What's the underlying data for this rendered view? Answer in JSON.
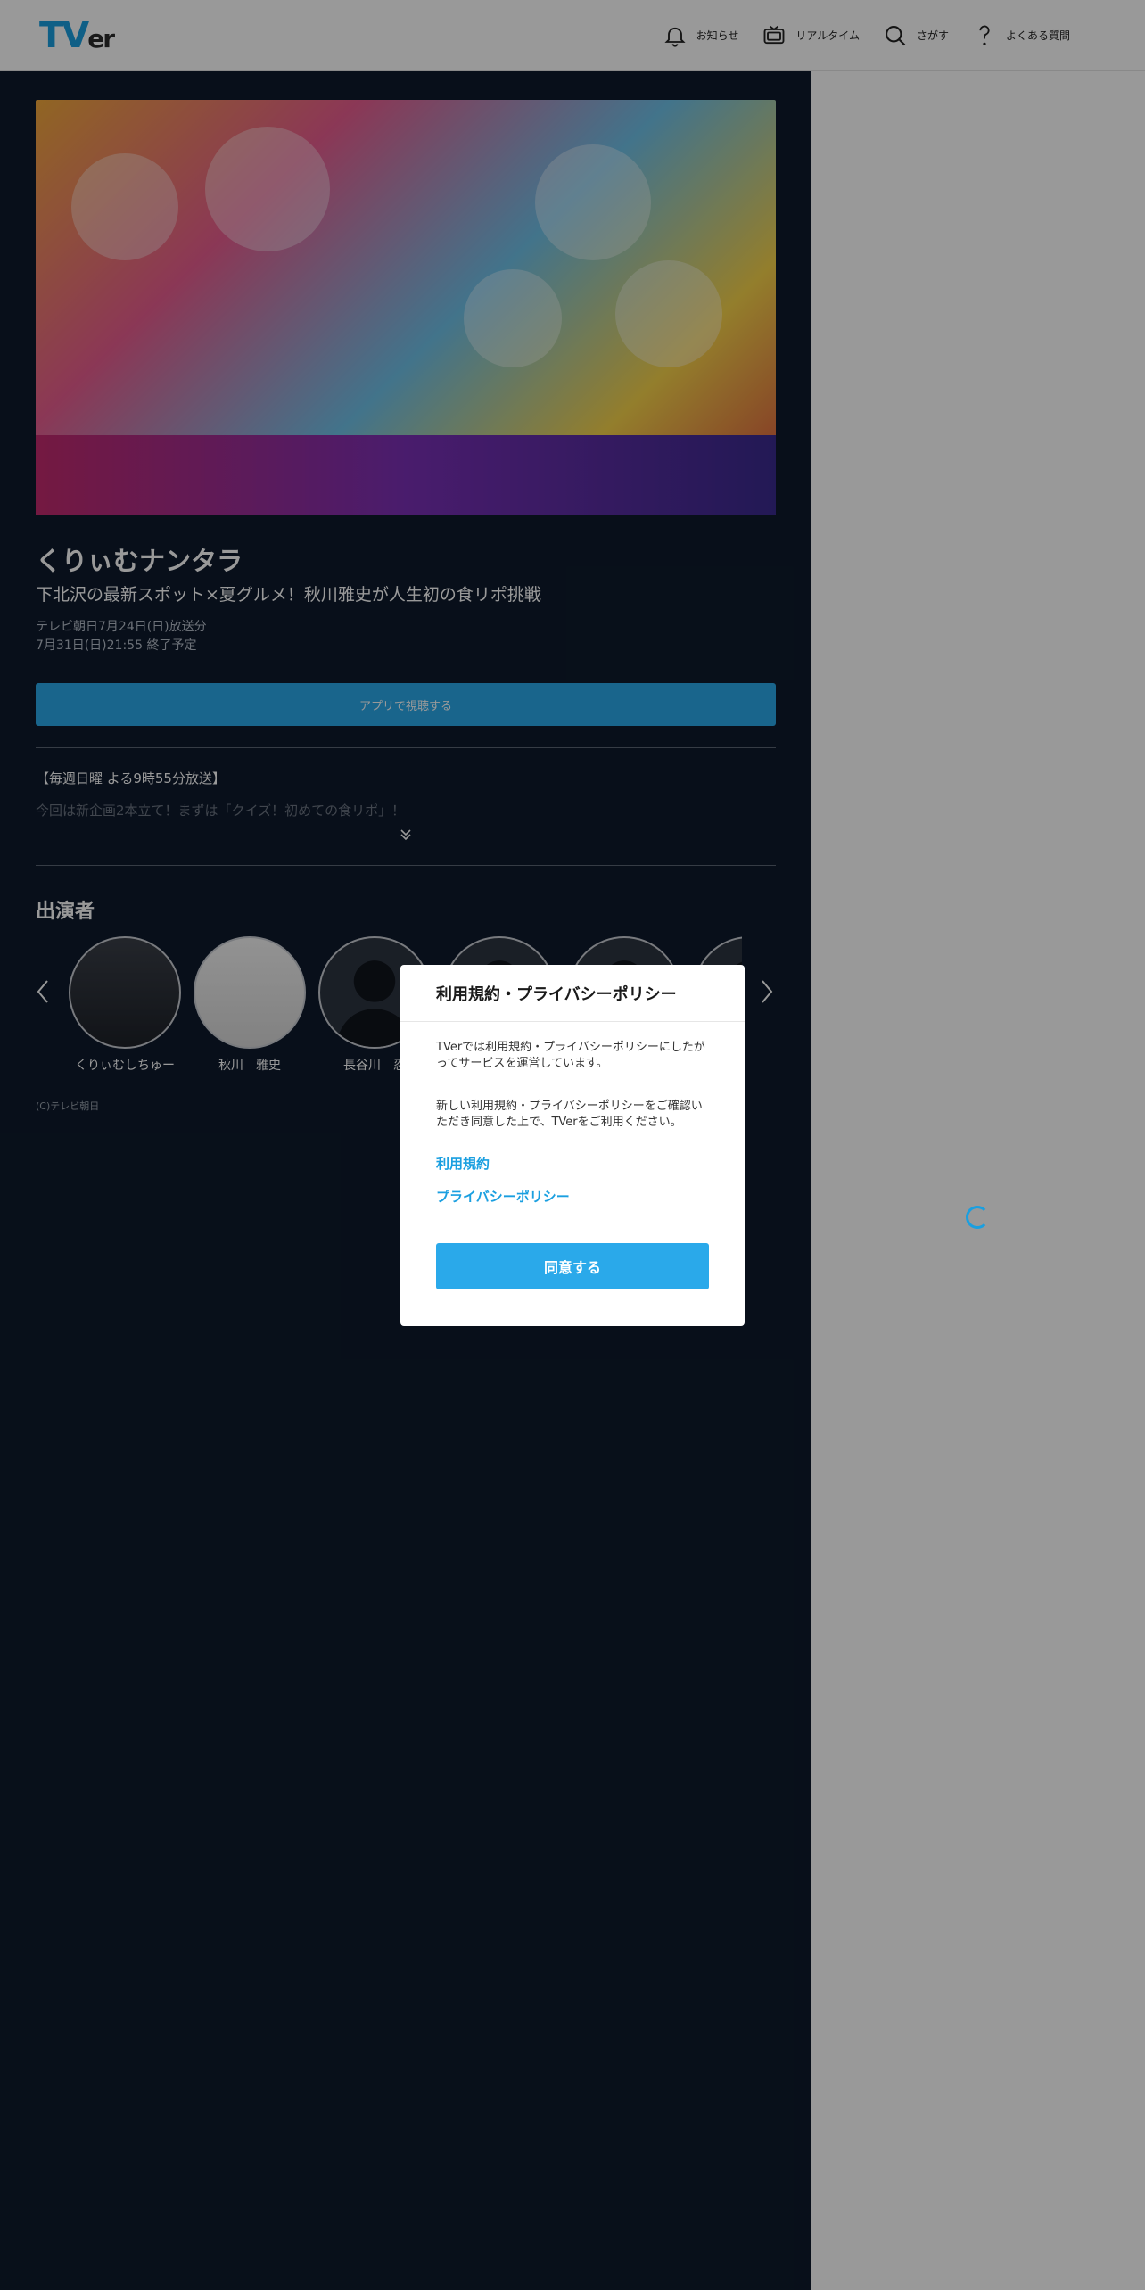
{
  "header": {
    "logo_main": "TV",
    "logo_tail": "er",
    "nav": [
      {
        "label": "お知らせ",
        "icon": "bell-icon"
      },
      {
        "label": "リアルタイム",
        "icon": "tv-icon"
      },
      {
        "label": "さがす",
        "icon": "search-icon"
      },
      {
        "label": "よくある質問",
        "icon": "question-icon"
      }
    ]
  },
  "episode": {
    "show_title": "くりぃむナンタラ",
    "episode_title": "下北沢の最新スポット×夏グルメ！秋川雅史が人生初の食リポ挑戦",
    "broadcast": "テレビ朝日7月24日(日)放送分",
    "expiry": "7月31日(日)21:55 終了予定",
    "cta_label": "アプリで視聴する",
    "description_line1": "【毎週日曜 よる9時55分放送】",
    "description_line2": "今回は新企画2本立て！まずは「クイズ！初めての食リポ」！"
  },
  "cast": {
    "heading": "出演者",
    "items": [
      {
        "name": "くりぃむしちゅー"
      },
      {
        "name": "秋川　雅史"
      },
      {
        "name": "長谷川　忍"
      },
      {
        "name": ""
      },
      {
        "name": ""
      },
      {
        "name": ""
      }
    ]
  },
  "copyright": "(C)テレビ朝日",
  "modal": {
    "title": "利用規約・プライバシーポリシー",
    "text1": "TVerでは利用規約・プライバシーポリシーにしたがってサービスを運営しています。",
    "text2": "新しい利用規約・プライバシーポリシーをご確認いただき同意した上で、TVerをご利用ください。",
    "link_terms": "利用規約",
    "link_privacy": "プライバシーポリシー",
    "agree_label": "同意する"
  },
  "colors": {
    "accent": "#2aa9ea",
    "main_bg": "#0e1a2c",
    "overlay": "rgba(0,0,0,0.4)"
  }
}
